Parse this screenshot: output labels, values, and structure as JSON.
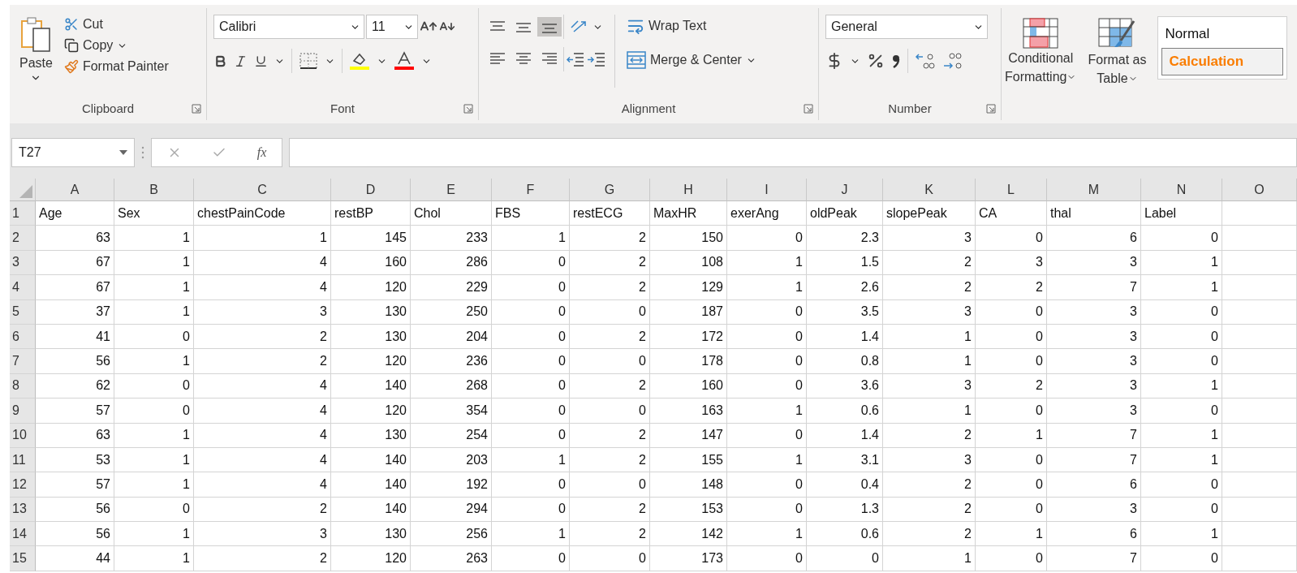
{
  "clipboard": {
    "label": "Clipboard",
    "paste": "Paste",
    "cut": "Cut",
    "copy": "Copy",
    "format_painter": "Format Painter"
  },
  "font": {
    "label": "Font",
    "font_name": "Calibri",
    "font_size": "11"
  },
  "alignment": {
    "label": "Alignment",
    "vertical": [
      {
        "selected": false
      },
      {
        "selected": false
      },
      {
        "selected": true
      }
    ],
    "horizontal": [
      {
        "selected": false
      },
      {
        "selected": false
      },
      {
        "selected": false
      }
    ],
    "wrap_text": "Wrap Text",
    "merge": "Merge & Center"
  },
  "number": {
    "label": "Number",
    "format": "General"
  },
  "styles": {
    "conditional": [
      "Conditional",
      "Formatting"
    ],
    "format_table": [
      "Format as",
      "Table"
    ],
    "cell_styles": [
      {
        "label": "Normal",
        "kind": "normal"
      },
      {
        "label": "Calculation",
        "kind": "calculation"
      }
    ]
  },
  "formula_bar": {
    "name_box": "T27",
    "fx": "fx"
  },
  "sheet": {
    "columns": [
      "A",
      "B",
      "C",
      "D",
      "E",
      "F",
      "G",
      "H",
      "I",
      "J",
      "K",
      "L",
      "M",
      "N",
      "O"
    ],
    "rows": [
      {
        "number": "1",
        "kind": "text",
        "cells": [
          "Age",
          "Sex",
          "chestPainCode",
          "restBP",
          "Chol",
          "FBS",
          "restECG",
          "MaxHR",
          "exerAng",
          "oldPeak",
          "slopePeak",
          "CA",
          "thal",
          "Label"
        ]
      },
      {
        "number": "2",
        "kind": "number",
        "cells": [
          "63",
          "1",
          "1",
          "145",
          "233",
          "1",
          "2",
          "150",
          "0",
          "2.3",
          "3",
          "0",
          "6",
          "0"
        ]
      },
      {
        "number": "3",
        "kind": "number",
        "cells": [
          "67",
          "1",
          "4",
          "160",
          "286",
          "0",
          "2",
          "108",
          "1",
          "1.5",
          "2",
          "3",
          "3",
          "1"
        ]
      },
      {
        "number": "4",
        "kind": "number",
        "cells": [
          "67",
          "1",
          "4",
          "120",
          "229",
          "0",
          "2",
          "129",
          "1",
          "2.6",
          "2",
          "2",
          "7",
          "1"
        ]
      },
      {
        "number": "5",
        "kind": "number",
        "cells": [
          "37",
          "1",
          "3",
          "130",
          "250",
          "0",
          "0",
          "187",
          "0",
          "3.5",
          "3",
          "0",
          "3",
          "0"
        ]
      },
      {
        "number": "6",
        "kind": "number",
        "cells": [
          "41",
          "0",
          "2",
          "130",
          "204",
          "0",
          "2",
          "172",
          "0",
          "1.4",
          "1",
          "0",
          "3",
          "0"
        ]
      },
      {
        "number": "7",
        "kind": "number",
        "cells": [
          "56",
          "1",
          "2",
          "120",
          "236",
          "0",
          "0",
          "178",
          "0",
          "0.8",
          "1",
          "0",
          "3",
          "0"
        ]
      },
      {
        "number": "8",
        "kind": "number",
        "cells": [
          "62",
          "0",
          "4",
          "140",
          "268",
          "0",
          "2",
          "160",
          "0",
          "3.6",
          "3",
          "2",
          "3",
          "1"
        ]
      },
      {
        "number": "9",
        "kind": "number",
        "cells": [
          "57",
          "0",
          "4",
          "120",
          "354",
          "0",
          "0",
          "163",
          "1",
          "0.6",
          "1",
          "0",
          "3",
          "0"
        ]
      },
      {
        "number": "10",
        "kind": "number",
        "cells": [
          "63",
          "1",
          "4",
          "130",
          "254",
          "0",
          "2",
          "147",
          "0",
          "1.4",
          "2",
          "1",
          "7",
          "1"
        ]
      },
      {
        "number": "11",
        "kind": "number",
        "cells": [
          "53",
          "1",
          "4",
          "140",
          "203",
          "1",
          "2",
          "155",
          "1",
          "3.1",
          "3",
          "0",
          "7",
          "1"
        ]
      },
      {
        "number": "12",
        "kind": "number",
        "cells": [
          "57",
          "1",
          "4",
          "140",
          "192",
          "0",
          "0",
          "148",
          "0",
          "0.4",
          "2",
          "0",
          "6",
          "0"
        ]
      },
      {
        "number": "13",
        "kind": "number",
        "cells": [
          "56",
          "0",
          "2",
          "140",
          "294",
          "0",
          "2",
          "153",
          "0",
          "1.3",
          "2",
          "0",
          "3",
          "0"
        ]
      },
      {
        "number": "14",
        "kind": "number",
        "cells": [
          "56",
          "1",
          "3",
          "130",
          "256",
          "1",
          "2",
          "142",
          "1",
          "0.6",
          "2",
          "1",
          "6",
          "1"
        ]
      },
      {
        "number": "15",
        "kind": "number",
        "cells": [
          "44",
          "1",
          "2",
          "120",
          "263",
          "0",
          "0",
          "173",
          "0",
          "0",
          "1",
          "0",
          "7",
          "0"
        ]
      }
    ]
  }
}
